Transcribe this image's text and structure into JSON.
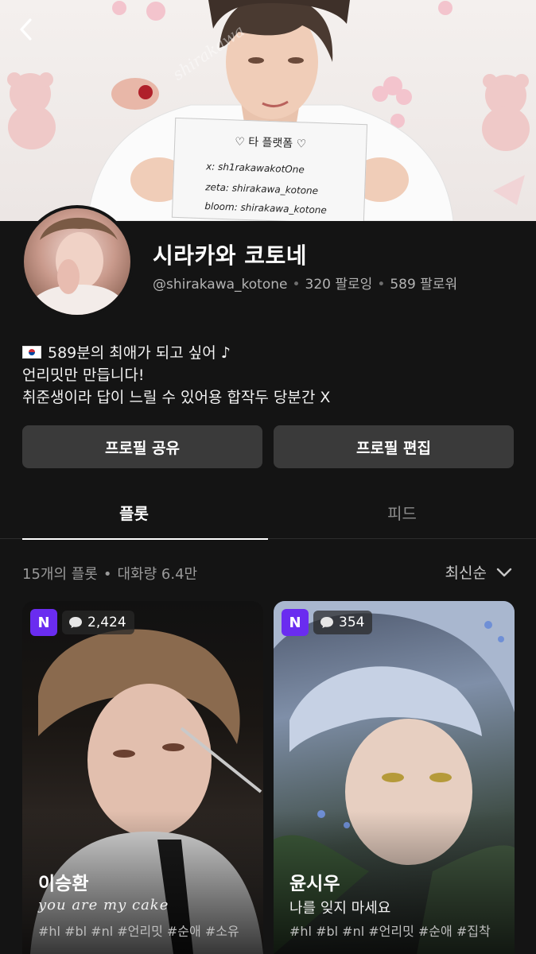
{
  "banner": {
    "sign_title": "♡ 타 플랫폼 ♡",
    "sign_lines": [
      "x: sh1rakawakotOne",
      "zeta: shirakawa_kotone",
      "bloom: shirakawa_kotone"
    ],
    "watermark": "shirakawa"
  },
  "profile": {
    "name": "시라카와 코토네",
    "handle": "@shirakawa_kotone",
    "following": "320 팔로잉",
    "followers": "589 팔로워",
    "bio": [
      "589분의 최애가 되고 싶어 ♪",
      "언리밋만 만듭니다!",
      "취준생이라 답이 느릴 수 있어용 합작두 당분간 X"
    ]
  },
  "actions": {
    "share_label": "프로필 공유",
    "edit_label": "프로필 편집"
  },
  "tabs": [
    {
      "label": "플롯",
      "active": true
    },
    {
      "label": "피드",
      "active": false
    }
  ],
  "list": {
    "count_text": "15개의 플롯",
    "volume_text": "대화량 6.4만",
    "sort_label": "최신순"
  },
  "cards": [
    {
      "badge": "N",
      "chats": "2,424",
      "title": "이승환",
      "subtitle": "you are my cake",
      "tags": "#hl #bl #nl #언리밋 #순애 #소유"
    },
    {
      "badge": "N",
      "chats": "354",
      "title": "윤시우",
      "subtitle": "나를 잊지 마세요",
      "tags": "#hl #bl #nl #언리밋 #순애 #집착"
    }
  ],
  "colors": {
    "background": "#141414",
    "button": "#3a3a3a",
    "badge": "#6a2cf0"
  }
}
